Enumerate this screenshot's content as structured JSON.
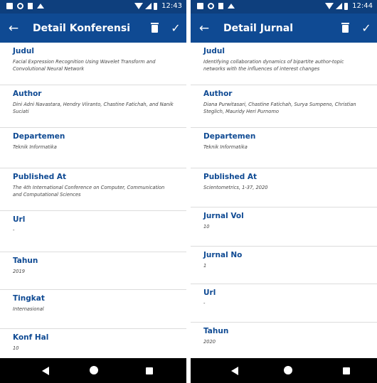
{
  "screens": [
    {
      "status": {
        "time": "12:43"
      },
      "appbar": {
        "title": "Detail Konferensi"
      },
      "fields": [
        {
          "label": "Judul",
          "value": "Facial Expression Recognition Using Wavelet Transform and Convolutional Neural Network"
        },
        {
          "label": "Author",
          "value": "Dini Adni Navastara, Hendry Viiranto, Chastine Fatichah, and Nanik Suciati"
        },
        {
          "label": "Departemen",
          "value": "Teknik Informatika"
        },
        {
          "label": "Published At",
          "value": "The 4th International Conference on Computer, Communication and Computational Sciences"
        },
        {
          "label": "Url",
          "value": "-"
        },
        {
          "label": "Tahun",
          "value": "2019"
        },
        {
          "label": "Tingkat",
          "value": "Internasional"
        },
        {
          "label": "Konf Hal",
          "value": "10"
        }
      ]
    },
    {
      "status": {
        "time": "12:44"
      },
      "appbar": {
        "title": "Detail Jurnal"
      },
      "fields": [
        {
          "label": "Judul",
          "value": "Identifying collaboration dynamics of bipartite author-topic networks with the influences of interest changes"
        },
        {
          "label": "Author",
          "value": "Diana Purwitasari, Chastine Fatichah, Surya Sumpeno, Christian Steglich, Mauridy Heri Purnomo"
        },
        {
          "label": "Departemen",
          "value": "Teknik Informatika"
        },
        {
          "label": "Published At",
          "value": "Scientometrics, 1-37, 2020"
        },
        {
          "label": "Jurnal Vol",
          "value": "10"
        },
        {
          "label": "Jurnal No",
          "value": "1"
        },
        {
          "label": "Url",
          "value": "-"
        },
        {
          "label": "Tahun",
          "value": "2020"
        }
      ]
    }
  ],
  "colors": {
    "primary": "#0f4a93",
    "status_bar": "#0e3f7d",
    "label": "#0f4a93",
    "divider": "#dcdcdc"
  },
  "icons": {
    "back": "arrow-left-icon",
    "delete": "trash-icon",
    "save": "check-icon"
  }
}
